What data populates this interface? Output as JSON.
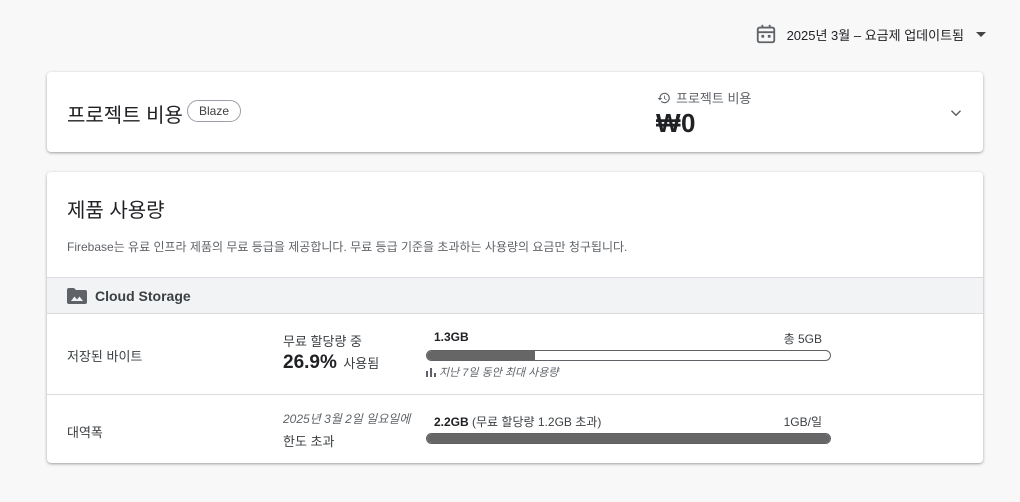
{
  "period_selector": {
    "label": "2025년 3월 – 요금제 업데이트됨"
  },
  "project_cost_card": {
    "title": "프로젝트 비용",
    "plan_badge": "Blaze",
    "cost_label": "프로젝트 비용",
    "cost_value": "₩0"
  },
  "usage_card": {
    "title": "제품 사용량",
    "description": "Firebase는 유료 인프라 제품의 무료 등급을 제공합니다. 무료 등급 기준을 초과하는 사용량의 요금만 청구됩니다.",
    "section": {
      "name": "Cloud Storage",
      "icon": "image-folder-icon"
    },
    "rows": [
      {
        "name": "저장된 바이트",
        "quota_label": "무료 할당량 중",
        "percent": "26.9%",
        "used_label": "사용됨",
        "bar_value": "1.3GB",
        "bar_total": "총 5GB",
        "fill_fraction": 0.269,
        "note": "지난 7일 동안 최대 사용량"
      },
      {
        "name": "대역폭",
        "limit_date": "2025년 3월 2일 일요일에",
        "limit_text": "한도 초과",
        "bar_value": "2.2GB",
        "bar_value_suffix": " (무료 할당량 1.2GB 초과)",
        "bar_total": "1GB/일",
        "fill_fraction": 1.0
      }
    ]
  },
  "colors": {
    "bar_fill": "#666666",
    "background": "#f8f8f8"
  }
}
